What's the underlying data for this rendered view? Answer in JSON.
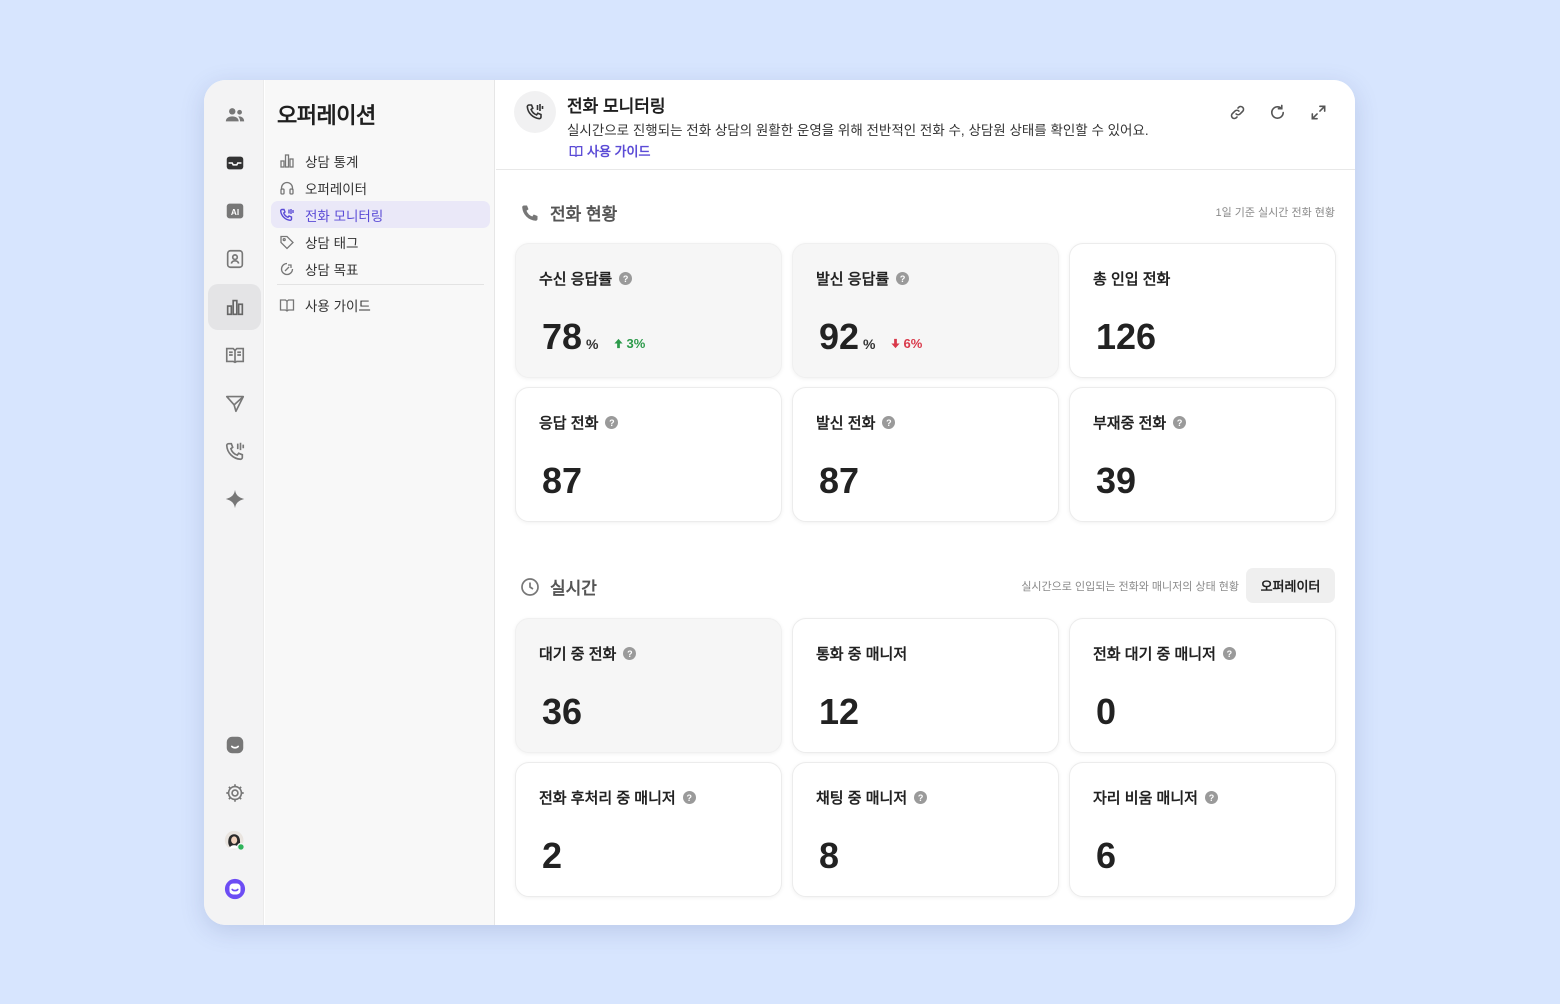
{
  "colors": {
    "accent": "#5b4bd6",
    "up": "#2c9a4a",
    "down": "#d9394a",
    "background": "#d7e5fe"
  },
  "rail": {
    "items": [
      "people-icon",
      "inbox-icon",
      "ai-icon",
      "contact-icon",
      "chart-icon",
      "book-icon",
      "send-icon",
      "phone-icon",
      "sparkle-icon"
    ],
    "bottom": [
      "chat-icon",
      "gear-icon",
      "avatar",
      "brand-icon"
    ]
  },
  "subnav": {
    "title": "오퍼레이션",
    "items": [
      {
        "label": "상담 통계",
        "icon": "bar-chart-icon"
      },
      {
        "label": "오퍼레이터",
        "icon": "headset-icon"
      },
      {
        "label": "전화 모니터링",
        "icon": "phone-monitor-icon"
      },
      {
        "label": "상담 태그",
        "icon": "tag-icon"
      },
      {
        "label": "상담 목표",
        "icon": "target-icon"
      }
    ],
    "guide": {
      "label": "사용 가이드",
      "icon": "book-icon"
    }
  },
  "header": {
    "title": "전화 모니터링",
    "description": "실시간으로 진행되는 전화 상담의 원활한 운영을 위해 전반적인 전화 수, 상담원 상태를 확인할 수 있어요.",
    "guide": "사용 가이드",
    "tools": [
      "link-icon",
      "refresh-icon",
      "expand-icon"
    ]
  },
  "call_status": {
    "title": "전화 현황",
    "note": "1일 기준 실시간 전화 현황",
    "cards": [
      {
        "label": "수신 응답률",
        "value": "78",
        "unit": "%",
        "delta": "3%",
        "help": "?"
      },
      {
        "label": "발신 응답률",
        "value": "92",
        "unit": "%",
        "delta": "6%",
        "help": "?"
      },
      {
        "label": "총 인입 전화",
        "value": "126"
      },
      {
        "label": "응답 전화",
        "value": "87",
        "help": "?"
      },
      {
        "label": "발신 전화",
        "value": "87",
        "help": "?"
      },
      {
        "label": "부재중 전화",
        "value": "39",
        "help": "?"
      }
    ]
  },
  "realtime": {
    "title": "실시간",
    "note": "실시간으로 인입되는 전화와 매니저의 상태 현황",
    "button": "오퍼레이터",
    "cards": [
      {
        "label": "대기 중 전화",
        "value": "36",
        "help": "?"
      },
      {
        "label": "통화 중 매니저",
        "value": "12"
      },
      {
        "label": "전화 대기 중 매니저",
        "value": "0",
        "help": "?"
      },
      {
        "label": "전화 후처리 중 매니저",
        "value": "2",
        "help": "?"
      },
      {
        "label": "채팅 중 매니저",
        "value": "8",
        "help": "?"
      },
      {
        "label": "자리 비움 매니저",
        "value": "6",
        "help": "?"
      }
    ]
  }
}
